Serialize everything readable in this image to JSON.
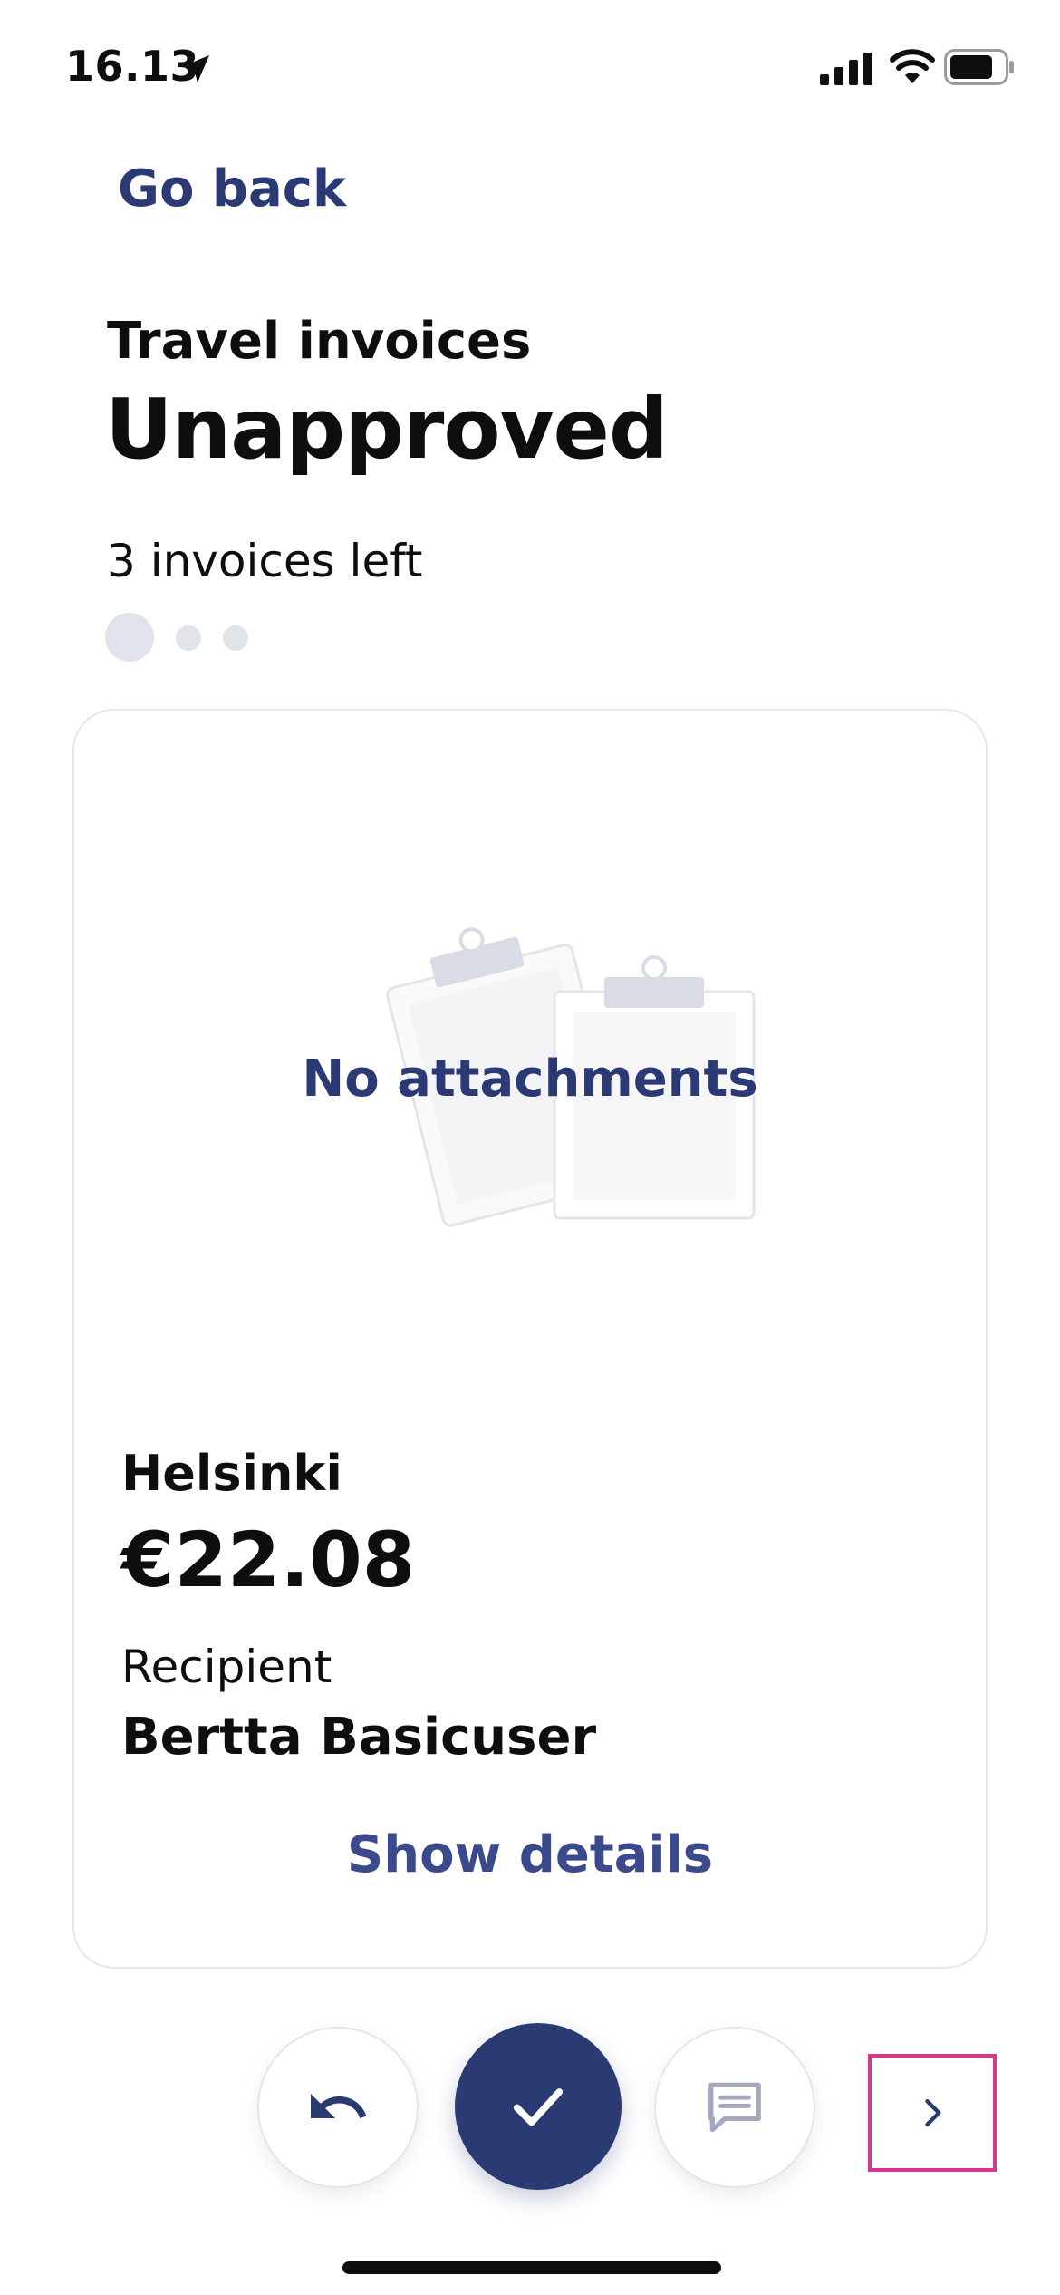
{
  "status_bar": {
    "time": "16.13",
    "location_icon": "location-arrow-icon",
    "signal_icon": "cellular-signal-icon",
    "wifi_icon": "wifi-icon",
    "battery_icon": "battery-icon"
  },
  "nav": {
    "go_back_label": "Go back"
  },
  "header": {
    "section": "Travel invoices",
    "title": "Unapproved",
    "invoices_left": "3 invoices left",
    "pager": {
      "count": 3,
      "active_index": 0
    }
  },
  "card": {
    "attachments_icon": "clipboard-illustration",
    "attachments_text": "No attachments",
    "location": "Helsinki",
    "amount": "€22.08",
    "recipient_label": "Recipient",
    "recipient_name": "Bertta Basicuser",
    "show_details_label": "Show details"
  },
  "actions": {
    "undo_icon": "undo-icon",
    "approve_icon": "checkmark-icon",
    "comment_icon": "comment-icon",
    "next_icon": "chevron-right-icon"
  },
  "colors": {
    "accent": "#2a3a72",
    "link": "#2b3a75",
    "highlight": "#d6388d",
    "card_border": "#e6e7ec",
    "dot": "#e1e3ea"
  }
}
